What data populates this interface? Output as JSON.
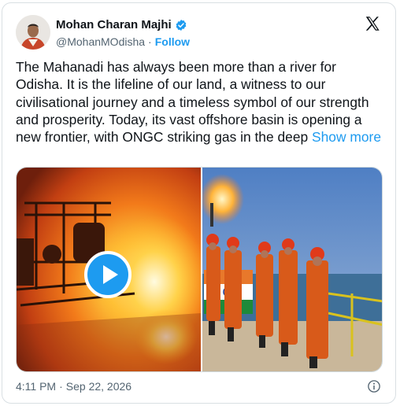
{
  "author": {
    "display_name": "Mohan Charan Majhi",
    "handle": "@MohanMOdisha",
    "separator": "·",
    "follow_label": "Follow",
    "verified_color": "#1d9bf0"
  },
  "tweet": {
    "text": "The Mahanadi has always been more than a river for Odisha. It is the lifeline of our land, a witness to our civilisational journey and a timeless symbol of our strength and prosperity. Today, its vast offshore basin is opening a new frontier, with ONGC striking gas in the deep",
    "show_more_label": "Show more"
  },
  "meta": {
    "time": "4:11 PM",
    "separator": "·",
    "date": "Sep 22, 2026"
  },
  "icons": {
    "logo": "x-logo-icon",
    "verified": "verified-badge-icon",
    "play": "play-icon",
    "info": "info-icon"
  },
  "colors": {
    "accent": "#1d9bf0",
    "text": "#0f1419",
    "secondary_text": "#536471"
  }
}
